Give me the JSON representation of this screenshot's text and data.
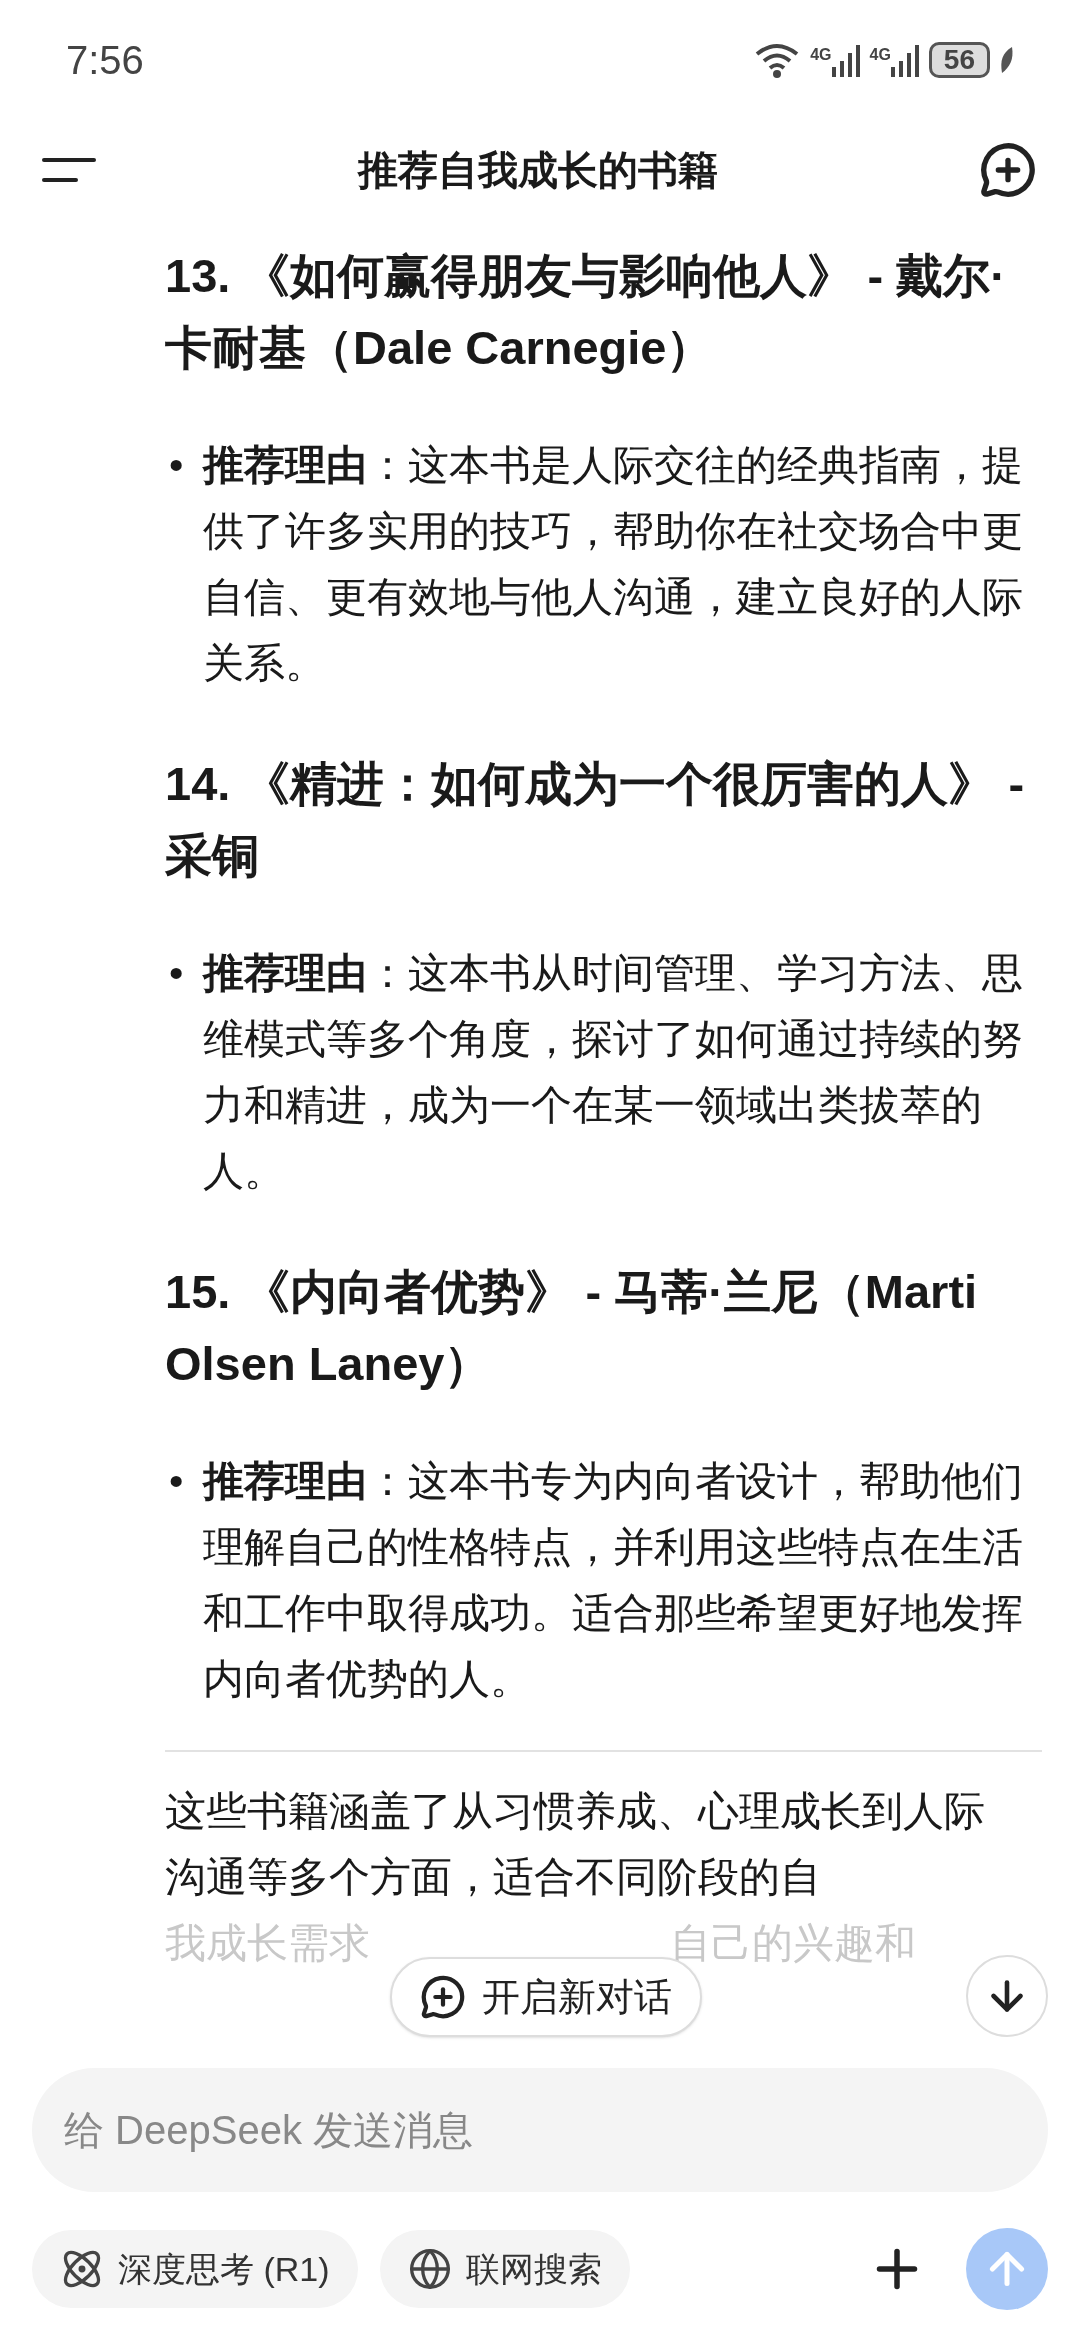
{
  "status_bar": {
    "time": "7:56",
    "network_1": "4G",
    "network_2": "4G",
    "battery": "56"
  },
  "header": {
    "title": "推荐自我成长的书籍"
  },
  "books": [
    {
      "heading": "13. 《如何赢得朋友与影响他人》 - 戴尔·卡耐基（Dale Carnegie）",
      "bullet": "•",
      "reason": "**推荐理由**：这本书是人际交往的经典指南，提供了许多实用的技巧，帮助你在社交场合中更自信、更有效地与他人沟通，建立良好的人际关系。"
    },
    {
      "heading": "14. 《精进：如何成为一个很厉害的人》 - 采铜",
      "bullet": "•",
      "reason": "**推荐理由**：这本书从时间管理、学习方法、思维模式等多个角度，探讨了如何通过持续的努力和精进，成为一个在某一领域出类拔萃的人。"
    },
    {
      "heading": "15. 《内向者优势》 - 马蒂·兰尼（Marti Olsen Laney）",
      "bullet": "•",
      "reason": "**推荐理由**：这本书专为内向者设计，帮助他们理解自己的性格特点，并利用这些特点在生活和工作中取得成功。适合那些希望更好地发挥内向者优势的人。"
    }
  ],
  "summary": {
    "text": "这些书籍涵盖了从习惯养成、心理成长到人际沟通等多个方面，适合不同阶段的自",
    "faded_left": "我成长需求",
    "faded_right": "自己的兴趣和"
  },
  "new_chat_button": {
    "label": "开启新对话"
  },
  "composer": {
    "placeholder": "给 DeepSeek 发送消息",
    "chips": [
      {
        "label": "深度思考 (R1)",
        "kind": "atom",
        "selected": false
      },
      {
        "label": "联网搜索",
        "kind": "globe",
        "selected": false
      }
    ]
  }
}
